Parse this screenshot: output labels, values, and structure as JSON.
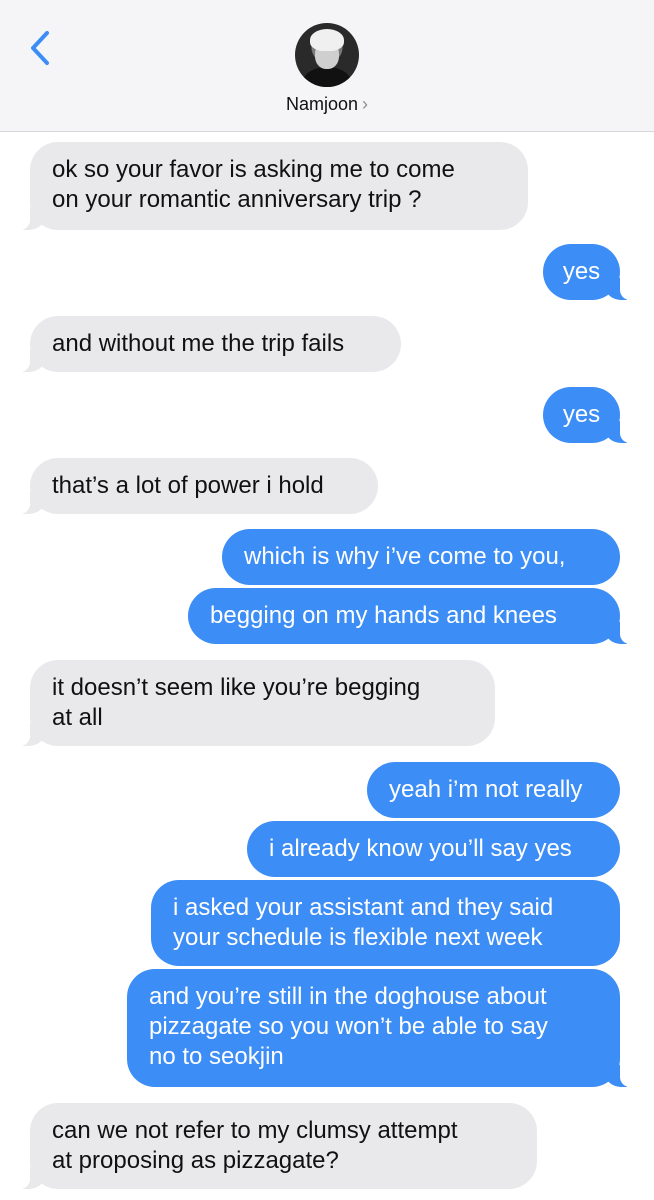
{
  "header": {
    "contact_name": "Namjoon",
    "chevron": "›",
    "back_icon": "chevron-left-icon",
    "accent_color": "#3c8df6"
  },
  "messages": [
    {
      "from": "Namjoon",
      "lines": [
        "ok so your favor is asking me to come",
        "on your romantic anniversary trip ?"
      ]
    },
    {
      "from": "me",
      "lines": [
        "yes"
      ]
    },
    {
      "from": "Namjoon",
      "lines": [
        "and without me the trip fails"
      ]
    },
    {
      "from": "me",
      "lines": [
        "yes"
      ]
    },
    {
      "from": "Namjoon",
      "lines": [
        "that’s a lot of power i hold"
      ]
    },
    {
      "from": "me",
      "lines": [
        "which is why i’ve come to you,"
      ]
    },
    {
      "from": "me",
      "lines": [
        "begging on my hands and knees"
      ]
    },
    {
      "from": "Namjoon",
      "lines": [
        "it doesn’t seem like you’re begging",
        "at all"
      ]
    },
    {
      "from": "me",
      "lines": [
        "yeah i’m not really"
      ]
    },
    {
      "from": "me",
      "lines": [
        "i already know you’ll say yes"
      ]
    },
    {
      "from": "me",
      "lines": [
        "i asked your assistant and they said",
        "your schedule is flexible next week"
      ]
    },
    {
      "from": "me",
      "lines": [
        "and you’re still in the doghouse about",
        "pizzagate so you won’t be able to say",
        "no to seokjin"
      ]
    },
    {
      "from": "Namjoon",
      "lines": [
        "can we not refer to my clumsy attempt",
        "at proposing as pizzagate?"
      ]
    }
  ]
}
